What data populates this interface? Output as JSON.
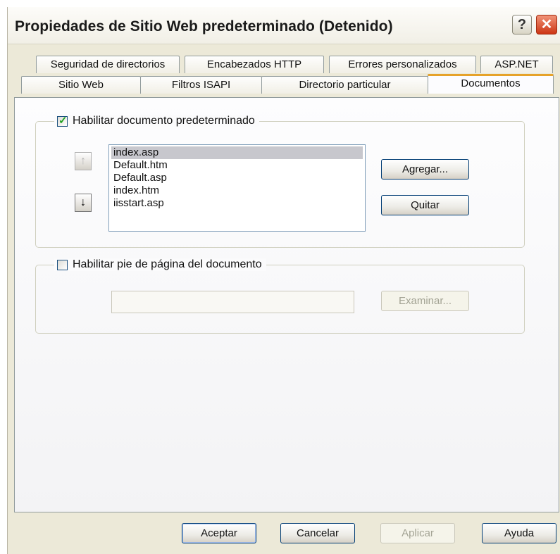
{
  "window": {
    "title": "Propiedades de Sitio Web predeterminado (Detenido)",
    "help_label": "?",
    "close_label": "✕"
  },
  "tabs_row1": [
    {
      "label": "Seguridad de directorios"
    },
    {
      "label": "Encabezados HTTP"
    },
    {
      "label": "Errores personalizados"
    },
    {
      "label": "ASP.NET"
    }
  ],
  "tabs_row2": [
    {
      "label": "Sitio Web"
    },
    {
      "label": "Filtros ISAPI"
    },
    {
      "label": "Directorio particular"
    },
    {
      "label": "Documentos",
      "active": true
    }
  ],
  "default_doc": {
    "checkbox_label": "Habilitar documento predeterminado",
    "checked": true,
    "up_arrow": "↑",
    "down_arrow": "↓",
    "items": [
      "index.asp",
      "Default.htm",
      "Default.asp",
      "index.htm",
      "iisstart.asp"
    ],
    "selected_index": 0,
    "add_label": "Agregar...",
    "remove_label": "Quitar"
  },
  "footer_doc": {
    "checkbox_label": "Habilitar pie de página del documento",
    "checked": false,
    "path_value": "",
    "browse_label": "Examinar..."
  },
  "buttons": {
    "ok": "Aceptar",
    "cancel": "Cancelar",
    "apply": "Aplicar",
    "help": "Ayuda"
  }
}
